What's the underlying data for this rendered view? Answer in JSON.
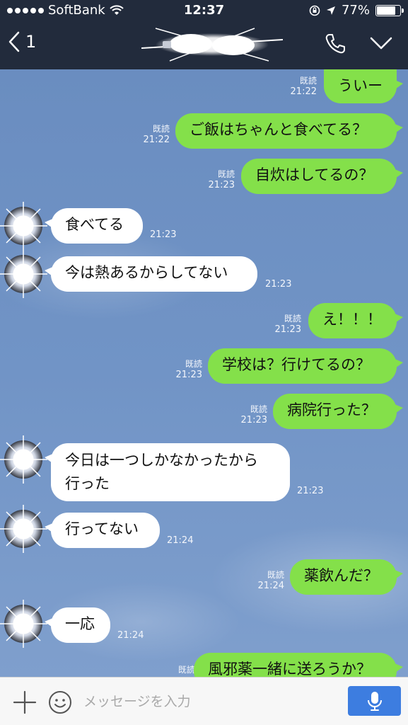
{
  "status": {
    "carrier": "SoftBank",
    "time": "12:37",
    "battery": "77%"
  },
  "header": {
    "back_count": "1"
  },
  "messages": [
    {
      "side": "out",
      "text": "ういー",
      "read": "既読",
      "time": "21:22"
    },
    {
      "side": "out",
      "text": "ご飯はちゃんと食べてる？",
      "read": "既読",
      "time": "21:22"
    },
    {
      "side": "out",
      "text": "自炊はしてるの？",
      "read": "既読",
      "time": "21:23"
    },
    {
      "side": "in",
      "text": "食べてる",
      "time": "21:23"
    },
    {
      "side": "in",
      "text": "今は熱あるからしてない",
      "time": "21:23"
    },
    {
      "side": "out",
      "text": "え！！！",
      "read": "既読",
      "time": "21:23"
    },
    {
      "side": "out",
      "text": "学校は？行けてるの？",
      "read": "既読",
      "time": "21:23"
    },
    {
      "side": "out",
      "text": "病院行った？",
      "read": "既読",
      "time": "21:23"
    },
    {
      "side": "in",
      "text_line1": "今日は一つしかなかったから",
      "text_line2": "行った",
      "time": "21:23"
    },
    {
      "side": "in",
      "text": "行ってない",
      "time": "21:24"
    },
    {
      "side": "out",
      "text": "薬飲んだ？",
      "read": "既読",
      "time": "21:24"
    },
    {
      "side": "in",
      "text": "一応",
      "time": "21:24"
    },
    {
      "side": "out",
      "text": "風邪薬一緒に送ろうか？",
      "read": "既読"
    }
  ],
  "input": {
    "placeholder": "メッセージを入力"
  },
  "colors": {
    "header_bg": "#222b3c",
    "outgoing_bubble": "#84e04a",
    "incoming_bubble": "#ffffff",
    "chat_bg": "#6f93c4",
    "mic_button": "#3d7de0"
  }
}
